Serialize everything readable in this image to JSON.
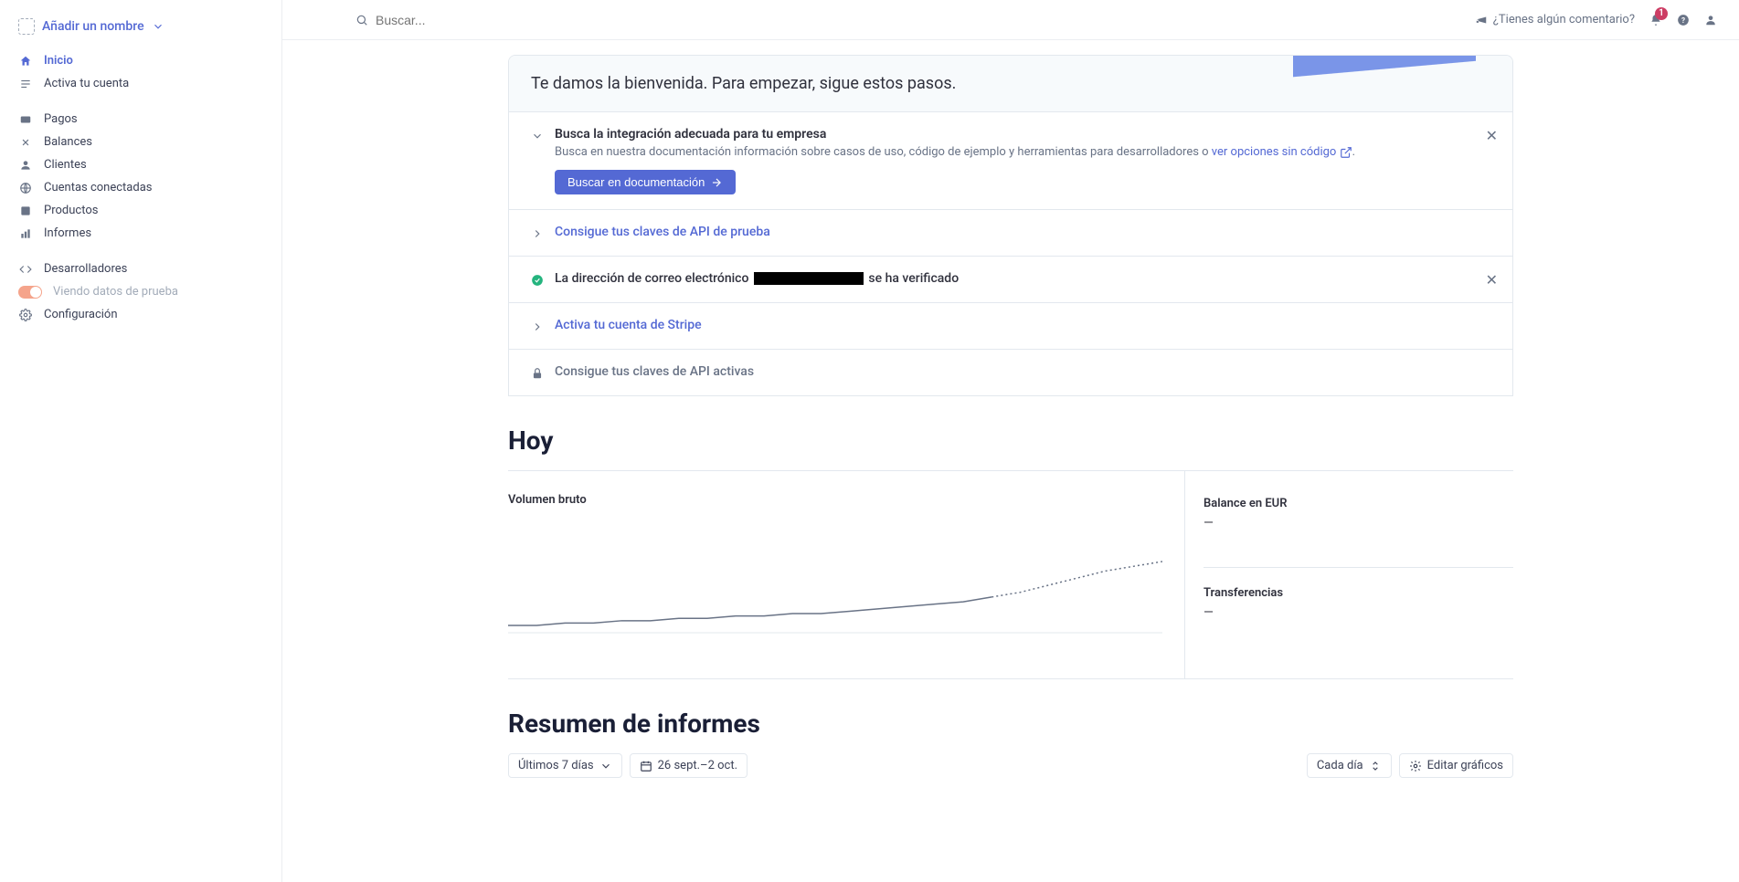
{
  "account": {
    "add_name": "Añadir un nombre"
  },
  "sidebar": {
    "items": [
      {
        "label": "Inicio",
        "active": true
      },
      {
        "label": "Activa tu cuenta"
      },
      {
        "label": "Pagos"
      },
      {
        "label": "Balances"
      },
      {
        "label": "Clientes"
      },
      {
        "label": "Cuentas conectadas"
      },
      {
        "label": "Productos"
      },
      {
        "label": "Informes"
      },
      {
        "label": "Desarrolladores"
      }
    ],
    "test_mode_label": "Viendo datos de prueba",
    "settings_label": "Configuración"
  },
  "topbar": {
    "search_placeholder": "Buscar...",
    "feedback": "¿Tienes algún comentario?",
    "notification_count": "1"
  },
  "welcome": {
    "title": "Te damos la bienvenida. Para empezar, sigue estos pasos.",
    "steps": {
      "integration": {
        "title": "Busca la integración adecuada para tu empresa",
        "desc_pre": "Busca en nuestra documentación información sobre casos de uso, código de ejemplo y herramientas para desarrolladores o ",
        "desc_link": "ver opciones sin código",
        "desc_post": ".",
        "button": "Buscar en documentación"
      },
      "api_test": {
        "title": "Consigue tus claves de API de prueba"
      },
      "email": {
        "pre": "La dirección de correo electrónico ",
        "post": " se ha verificado"
      },
      "activate": {
        "title": "Activa tu cuenta de Stripe"
      },
      "api_live": {
        "title": "Consigue tus claves de API activas"
      }
    }
  },
  "today": {
    "heading": "Hoy",
    "volume_label": "Volumen bruto",
    "balance_label": "Balance en EUR",
    "balance_value": "—",
    "transfers_label": "Transferencias",
    "transfers_value": "—"
  },
  "reports": {
    "heading": "Resumen de informes",
    "period": "Últimos 7 días",
    "date_range": "26 sept.–2 oct.",
    "granularity": "Cada día",
    "edit_charts": "Editar gráficos"
  },
  "chart_data": {
    "type": "line",
    "title": "Volumen bruto",
    "x": [
      0,
      1,
      2,
      3,
      4,
      5,
      6,
      7,
      8,
      9,
      10,
      11,
      12,
      13,
      14,
      15,
      16,
      17,
      18,
      19,
      20,
      21,
      22,
      23
    ],
    "values": [
      5,
      5,
      6,
      6,
      7,
      7,
      8,
      8,
      9,
      9,
      10,
      10,
      11,
      12,
      13,
      14,
      15,
      17,
      19,
      22,
      25,
      28,
      30,
      32
    ],
    "y_solid_end_index": 17
  }
}
